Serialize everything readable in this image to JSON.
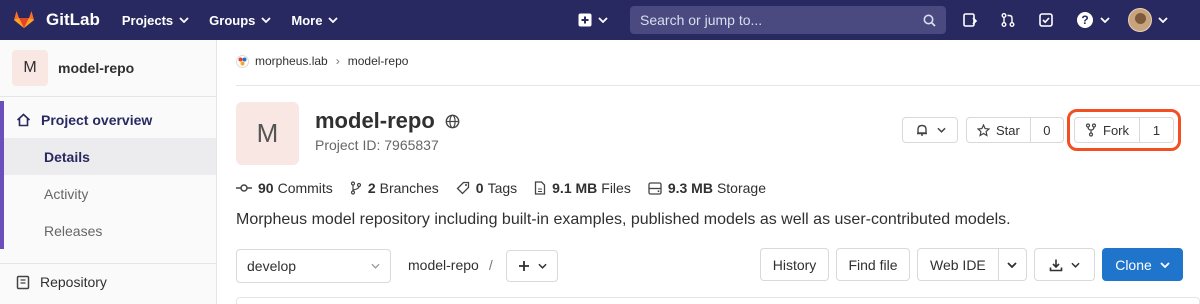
{
  "navbar": {
    "brand": "GitLab",
    "menu": [
      {
        "label": "Projects"
      },
      {
        "label": "Groups"
      },
      {
        "label": "More"
      }
    ],
    "search_placeholder": "Search or jump to..."
  },
  "sidebar": {
    "project_initial": "M",
    "project_name": "model-repo",
    "overview_label": "Project overview",
    "sub_items": [
      {
        "label": "Details"
      },
      {
        "label": "Activity"
      },
      {
        "label": "Releases"
      }
    ],
    "repository_label": "Repository"
  },
  "breadcrumb": {
    "group": "morpheus.lab",
    "project": "model-repo"
  },
  "project": {
    "initial": "M",
    "name": "model-repo",
    "id_text": "Project ID: 7965837",
    "star_label": "Star",
    "star_count": "0",
    "fork_label": "Fork",
    "fork_count": "1",
    "stats": [
      {
        "value": "90",
        "label": "Commits"
      },
      {
        "value": "2",
        "label": "Branches"
      },
      {
        "value": "0",
        "label": "Tags"
      },
      {
        "value": "9.1 MB",
        "label": "Files"
      },
      {
        "value": "9.3 MB",
        "label": "Storage"
      }
    ],
    "description": "Morpheus model repository including built-in examples, published models as well as user-contributed models."
  },
  "toolbar": {
    "branch": "develop",
    "path": "model-repo",
    "path_sep": "/",
    "history": "History",
    "find_file": "Find file",
    "web_ide": "Web IDE",
    "clone": "Clone"
  },
  "colors": {
    "navbar": "#292961",
    "accent": "#6b4fbb",
    "clone_button": "#1f75cb",
    "highlight": "#f25022"
  }
}
